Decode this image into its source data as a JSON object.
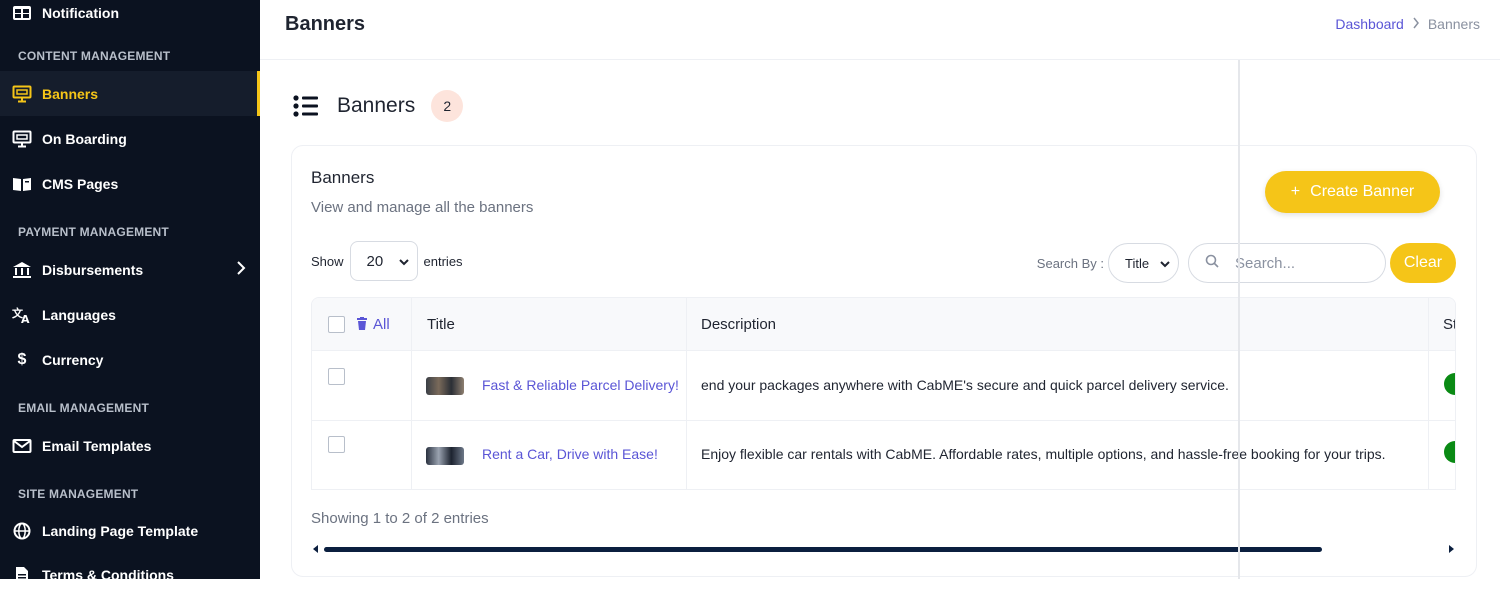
{
  "sidebar": {
    "items": [
      {
        "label": "Notification",
        "icon": "grid-icon"
      },
      {
        "label": "Banners",
        "icon": "monitor-icon",
        "active": true
      },
      {
        "label": "On Boarding",
        "icon": "monitor-icon"
      },
      {
        "label": "CMS Pages",
        "icon": "book-icon"
      },
      {
        "label": "Disbursements",
        "icon": "bank-icon"
      },
      {
        "label": "Languages",
        "icon": "translate-icon"
      },
      {
        "label": "Currency",
        "icon": "dollar-icon"
      },
      {
        "label": "Email Templates",
        "icon": "mail-icon"
      },
      {
        "label": "Landing Page Template",
        "icon": "globe-icon"
      },
      {
        "label": "Terms & Conditions",
        "icon": "file-icon"
      }
    ],
    "sections": {
      "content": "CONTENT MANAGEMENT",
      "payment": "PAYMENT MANAGEMENT",
      "email": "EMAIL MANAGEMENT",
      "site": "SITE MANAGEMENT"
    }
  },
  "header": {
    "title": "Banners",
    "breadcrumb": [
      "Dashboard",
      "Banners"
    ]
  },
  "main": {
    "heading": "Banners",
    "count": "2",
    "card_title": "Banners",
    "card_subtitle": "View and manage all the banners",
    "create_button": "Create Banner",
    "show_label": "Show",
    "entries_value": "20",
    "entries_label": "entries",
    "search_by_label": "Search By :",
    "search_by_value": "Title",
    "search_placeholder": "Search...",
    "clear_button": "Clear",
    "columns": [
      "All",
      "Title",
      "Description",
      "St"
    ],
    "rows": [
      {
        "title": "Fast & Reliable Parcel Delivery!",
        "description": "end your packages anywhere with CabME's secure and quick parcel delivery service."
      },
      {
        "title": "Rent a Car, Drive with Ease!",
        "description": "Enjoy flexible car rentals with CabME. Affordable rates, multiple options, and hassle-free booking for your trips."
      }
    ],
    "showing_text": "Showing 1 to 2 of 2 entries"
  },
  "colors": {
    "sidebar_bg": "#0b1220",
    "accent": "#f5c518",
    "link": "#5a55d6",
    "status_on": "#0a8a14"
  }
}
